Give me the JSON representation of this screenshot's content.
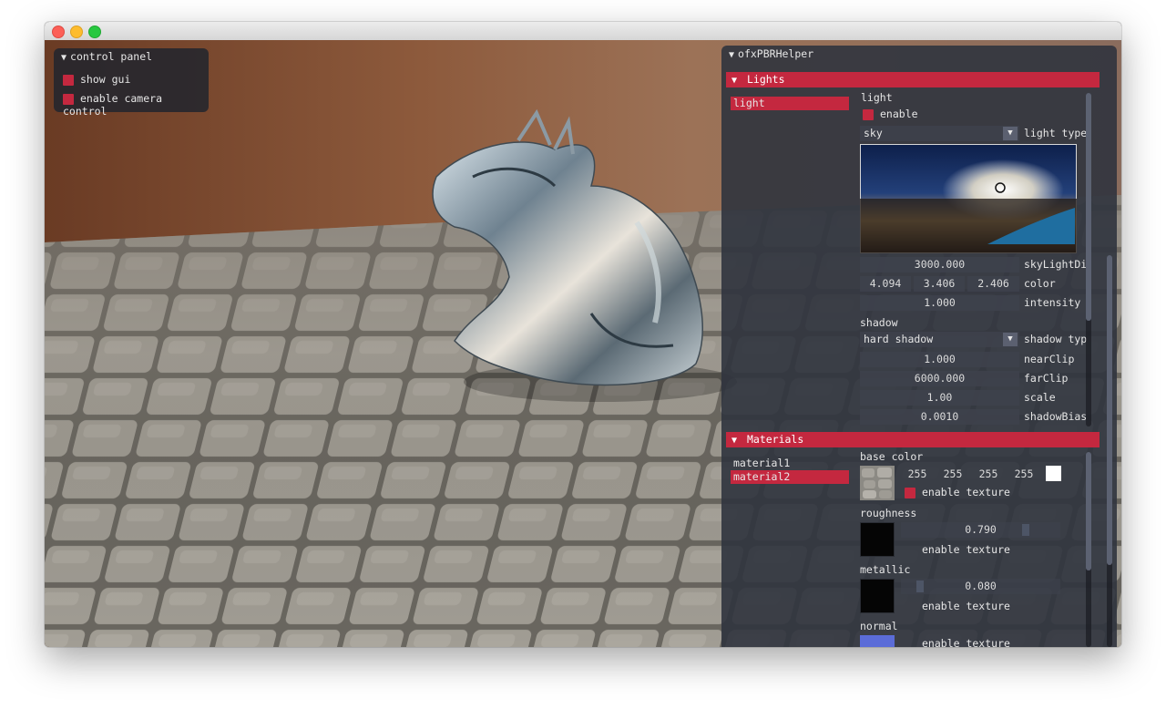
{
  "control_panel": {
    "title": "control panel",
    "items": [
      {
        "label": "show gui",
        "checked": true
      },
      {
        "label": "enable camera control",
        "checked": true
      }
    ]
  },
  "pbr_helper": {
    "title": "ofxPBRHelper",
    "lights": {
      "header": "Lights",
      "list": [
        {
          "label": "light",
          "selected": true
        }
      ],
      "group_label": "light",
      "enable_label": "enable",
      "type_value": "sky",
      "type_label": "light type",
      "sky_light_distance": "3000.000",
      "sky_light_distance_label": "skyLightDi",
      "color_values": [
        "4.094",
        "3.406",
        "2.406"
      ],
      "color_label": "color",
      "intensity_value": "1.000",
      "intensity_label": "intensity",
      "shadow_label": "shadow",
      "shadow_type_value": "hard shadow",
      "shadow_type_label": "shadow typ",
      "near_clip_value": "1.000",
      "near_clip_label": "nearClip",
      "far_clip_value": "6000.000",
      "far_clip_label": "farClip",
      "scale_value": "1.00",
      "scale_label": "scale",
      "shadow_bias_value": "0.0010",
      "shadow_bias_label": "shadowBias"
    },
    "materials": {
      "header": "Materials",
      "list": [
        {
          "label": "material1",
          "selected": false
        },
        {
          "label": "material2",
          "selected": true
        }
      ],
      "base_color_label": "base color",
      "base_color_values": [
        "255",
        "255",
        "255",
        "255"
      ],
      "enable_texture_label": "enable texture",
      "roughness_label": "roughness",
      "roughness_value": "0.790",
      "metallic_label": "metallic",
      "metallic_value": "0.080",
      "normal_label": "normal"
    }
  },
  "colors": {
    "accent": "#c4283f",
    "panel_bg": "#30343e"
  }
}
